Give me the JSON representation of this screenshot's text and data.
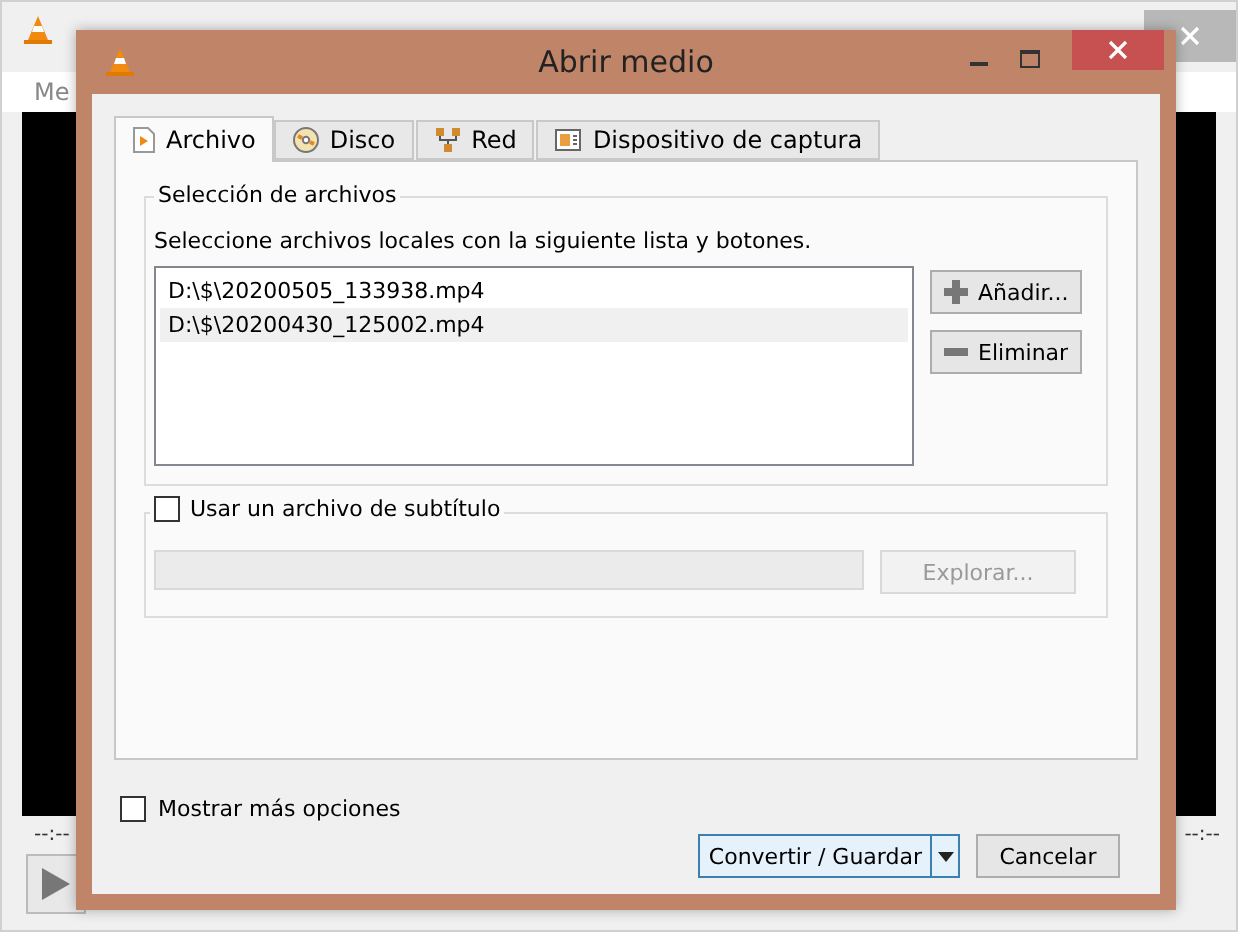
{
  "background_window": {
    "menu": [
      "Me"
    ],
    "time_left": "--:--",
    "time_right": "--:--"
  },
  "dialog": {
    "title": "Abrir medio",
    "tabs": [
      {
        "label": "Archivo",
        "selected": true
      },
      {
        "label": "Disco",
        "selected": false
      },
      {
        "label": "Red",
        "selected": false
      },
      {
        "label": "Dispositivo de captura",
        "selected": false
      }
    ],
    "file_group": {
      "title": "Selección de archivos",
      "description": "Seleccione archivos locales con la siguiente lista y botones.",
      "files": [
        {
          "name": "D:\\$\\20200505_133938.mp4",
          "selected": false
        },
        {
          "name": "D:\\$\\20200430_125002.mp4",
          "selected": true
        }
      ],
      "buttons": [
        {
          "label": "Añadir..."
        },
        {
          "label": "Eliminar"
        }
      ]
    },
    "subtitle": {
      "label": "Usar un archivo de subtítulo",
      "checked": false,
      "browse": "Explorar...",
      "disabled": true
    },
    "more_options": {
      "label": "Mostrar más opciones",
      "checked": false
    },
    "actions": [
      {
        "label": "Convertir / Guardar",
        "kind": "split",
        "default": true
      },
      {
        "label": "Cancelar",
        "kind": "plain",
        "default": false
      }
    ]
  }
}
